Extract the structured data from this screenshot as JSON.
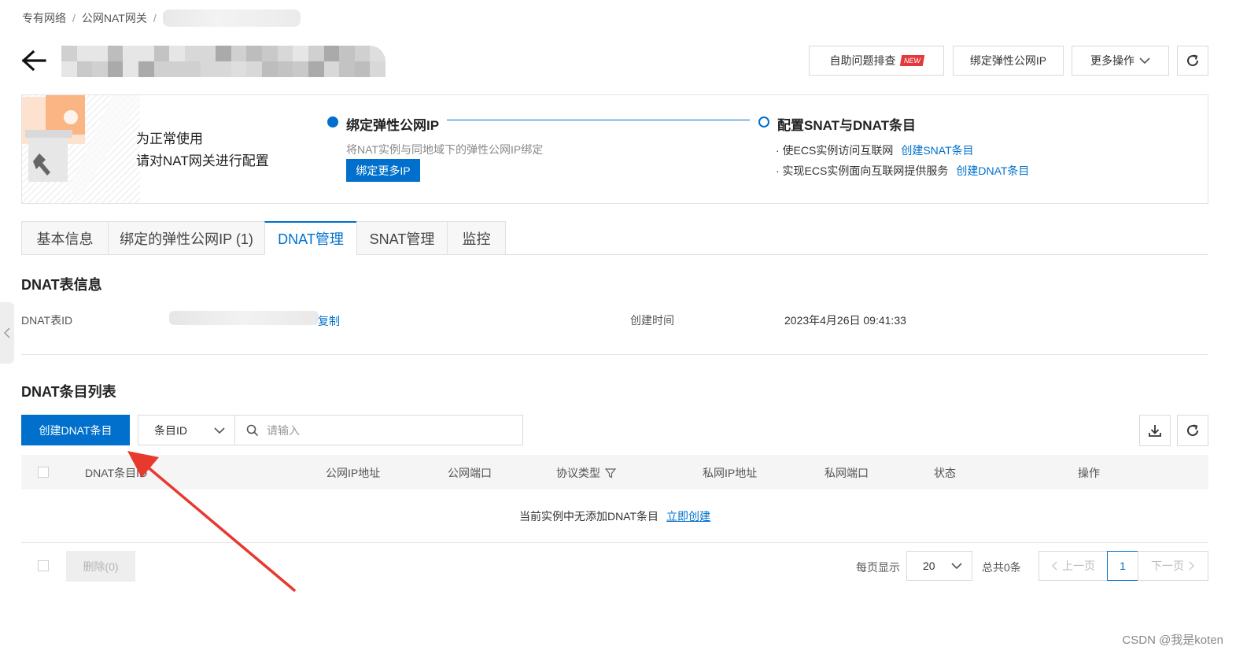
{
  "breadcrumb": {
    "items": [
      "专有网络",
      "公网NAT网关"
    ],
    "separator": "/"
  },
  "header": {
    "buttons": {
      "troubleshoot": "自助问题排查",
      "new_badge": "NEW",
      "bind_eip": "绑定弹性公网IP",
      "more_ops": "更多操作"
    }
  },
  "guide": {
    "intro_line1": "为正常使用",
    "intro_line2": "请对NAT网关进行配置",
    "step1": {
      "title": "绑定弹性公网IP",
      "desc": "将NAT实例与同地域下的弹性公网IP绑定",
      "button": "绑定更多IP"
    },
    "step2": {
      "title": "配置SNAT与DNAT条目",
      "items": [
        {
          "text": "· 使ECS实例访问互联网",
          "link": "创建SNAT条目"
        },
        {
          "text": "· 实现ECS实例面向互联网提供服务",
          "link": "创建DNAT条目"
        }
      ]
    }
  },
  "tabs": [
    "基本信息",
    "绑定的弹性公网IP (1)",
    "DNAT管理",
    "SNAT管理",
    "监控"
  ],
  "active_tab": "DNAT管理",
  "dnat_info": {
    "section_title": "DNAT表信息",
    "id_label": "DNAT表ID",
    "copy_link": "复制",
    "created_label": "创建时间",
    "created_value": "2023年4月26日 09:41:33"
  },
  "dnat_list": {
    "section_title": "DNAT条目列表",
    "create_button": "创建DNAT条目",
    "filter_select": "条目ID",
    "search_placeholder": "请输入",
    "columns": [
      "DNAT条目ID",
      "公网IP地址",
      "公网端口",
      "协议类型",
      "私网IP地址",
      "私网端口",
      "状态",
      "操作"
    ],
    "empty_text": "当前实例中无添加DNAT条目",
    "empty_link": "立即创建"
  },
  "footer": {
    "delete_button": "删除(0)",
    "per_page_label": "每页显示",
    "per_page_value": "20",
    "total_text": "总共0条",
    "prev_label": "上一页",
    "current_page": "1",
    "next_label": "下一页"
  },
  "watermark": "CSDN @我是koten",
  "colors": {
    "primary": "#0070cc",
    "badge": "#e4393c",
    "annotation_arrow": "#e8392f"
  },
  "icons": [
    "back-arrow-icon",
    "chevron-down-icon",
    "refresh-icon",
    "search-icon",
    "download-icon",
    "filter-icon",
    "chevron-left-icon",
    "chevron-right-icon",
    "wrench-icon",
    "gear-icon"
  ]
}
